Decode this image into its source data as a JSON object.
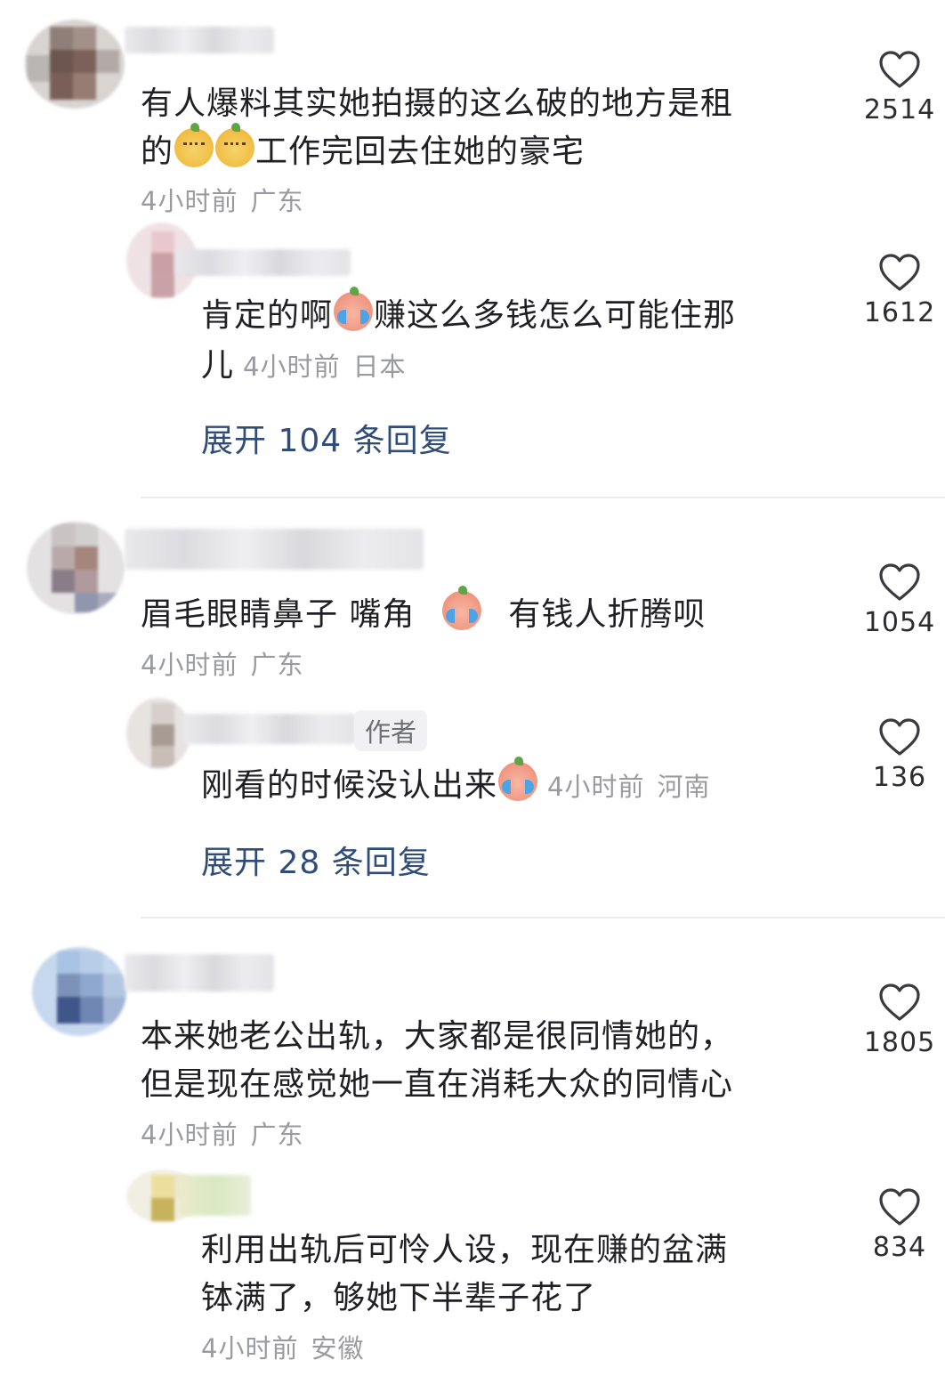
{
  "comments": [
    {
      "text_lines": [
        "有人爆料其实她拍摄的这么破的地方是租",
        "工作完回去住她的豪宅"
      ],
      "line2_prefix": "的",
      "time": "4小时前",
      "location": "广东",
      "likes": "2514",
      "emoji1": "face-emoji-icon",
      "reply": {
        "text_line1": "肯定的啊",
        "text_line1_b": "赚这么多钱怎么可能住那",
        "text_line2": "儿",
        "time": "4小时前",
        "location": "日本",
        "likes": "1612"
      },
      "expand_label": "展开 104 条回复"
    },
    {
      "text_a": "眉毛眼睛鼻子 嘴角",
      "text_b": "有钱人折腾呗",
      "time": "4小时前",
      "location": "广东",
      "likes": "1054",
      "reply": {
        "author_tag": "作者",
        "text": "刚看的时候没认出来",
        "time": "4小时前",
        "location": "河南",
        "likes": "136"
      },
      "expand_label": "展开 28 条回复"
    },
    {
      "text_lines": [
        "本来她老公出轨，大家都是很同情她的，",
        "但是现在感觉她一直在消耗大众的同情心"
      ],
      "time": "4小时前",
      "location": "广东",
      "likes": "1805",
      "reply": {
        "text_lines": [
          "利用出轨后可怜人设，现在赚的盆满",
          "钵满了，够她下半辈子花了"
        ],
        "time": "4小时前",
        "location": "安徽",
        "likes": "834"
      }
    }
  ],
  "colors": {
    "expand_link": "#2f4d78",
    "meta": "#9a9aa1",
    "divider": "#ececef"
  }
}
